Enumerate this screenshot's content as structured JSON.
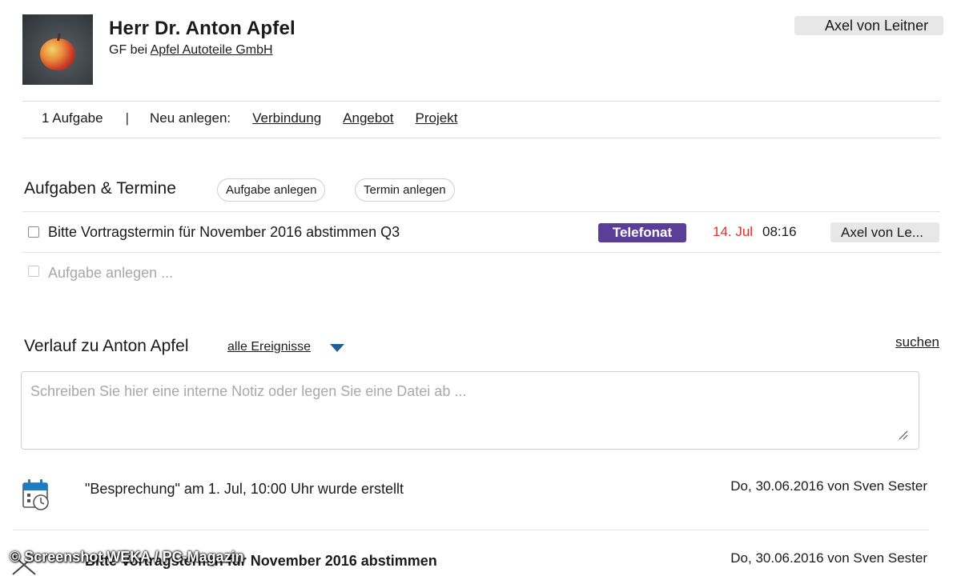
{
  "contact": {
    "name": "Herr Dr. Anton Apfel",
    "role_prefix": "GF bei",
    "company": "Apfel Autoteile GmbH",
    "owner": "Axel von Leitner"
  },
  "actionbar": {
    "task_count": "1 Aufgabe",
    "separator": "|",
    "new_label": "Neu anlegen:",
    "links": [
      "Verbindung",
      "Angebot",
      "Projekt"
    ]
  },
  "tasks": {
    "title": "Aufgaben & Termine",
    "add_task_button": "Aufgabe anlegen",
    "add_appointment_button": "Termin anlegen",
    "items": [
      {
        "text": "Bitte Vortragstermin für November 2016 abstimmen Q3",
        "type": "Telefonat",
        "date": "14. Jul",
        "time": "08:16",
        "assignee": "Axel von Le..."
      }
    ],
    "new_task_placeholder": "Aufgabe anlegen ..."
  },
  "history": {
    "title": "Verlauf zu Anton Apfel",
    "filter": "alle Ereignisse",
    "search": "suchen",
    "note_placeholder": "Schreiben Sie hier eine interne Notiz oder legen Sie eine Datei ab ...",
    "events": [
      {
        "text": "\"Besprechung\" am 1. Jul, 10:00 Uhr wurde erstellt",
        "meta": "Do, 30.06.2016 von Sven Sester"
      },
      {
        "text": "Bitte Vortragstermin für November 2016 abstimmen",
        "meta": "Do, 30.06.2016 von Sven Sester"
      }
    ]
  },
  "watermark": "© Screenshot WEKA / PC-Magazin",
  "colors": {
    "badge": "#5a3e98",
    "due_date": "#e0312b",
    "icon_blue": "#1f7bc1",
    "caret": "#1f5f97"
  }
}
